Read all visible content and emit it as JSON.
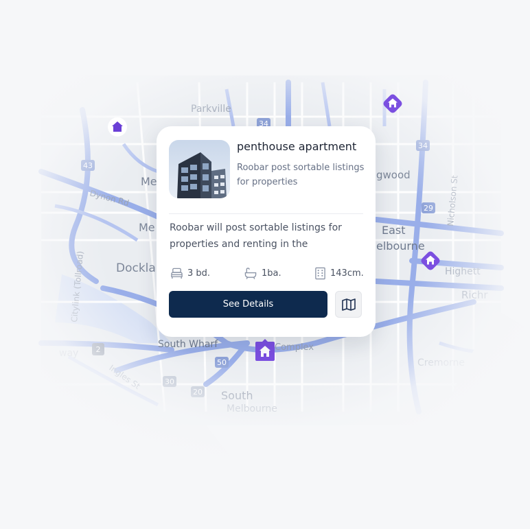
{
  "map": {
    "labels": {
      "parkville": "Parkville",
      "dynon_rd": "Dynon Rd",
      "docklands": "Dockla",
      "melbourne_w": "Me",
      "melbourne_w2": "Me",
      "east_melbourne_1": "East",
      "east_melbourne_2": "elbourne",
      "collingwood": "gwood",
      "highett": "Highett",
      "rich": "Richr",
      "nicholson": "Nicholson St",
      "south_wharf": "South Wharf",
      "south_melbourne_1": "South",
      "south_melbourne_2": "Melbourne",
      "cremorne": "Cremorne",
      "ingles": "Ingles St",
      "citylink": "Citylink (Tollroad)",
      "way": "way",
      "complex": "Complex",
      "shield_43": "43",
      "shield_34a": "34",
      "shield_34b": "34",
      "shield_29": "29",
      "shield_30": "30",
      "shield_20": "20",
      "shield_50": "50",
      "shield_2": "2"
    },
    "pin_icons": [
      "home-icon",
      "home-icon",
      "home-icon",
      "home-icon"
    ]
  },
  "card": {
    "title": "penthouse apartment",
    "subtitle": "Roobar post sortable listings for properties",
    "description": "Roobar will post sortable listings for properties and renting in the",
    "features": {
      "beds": "3 bd.",
      "baths": "1ba.",
      "area": "143cm."
    },
    "details_label": "See Details",
    "map_button_icon": "map-icon"
  },
  "colors": {
    "accent": "#7b4fe0",
    "button": "#0e2a4e",
    "road": "#8fa7e8"
  }
}
